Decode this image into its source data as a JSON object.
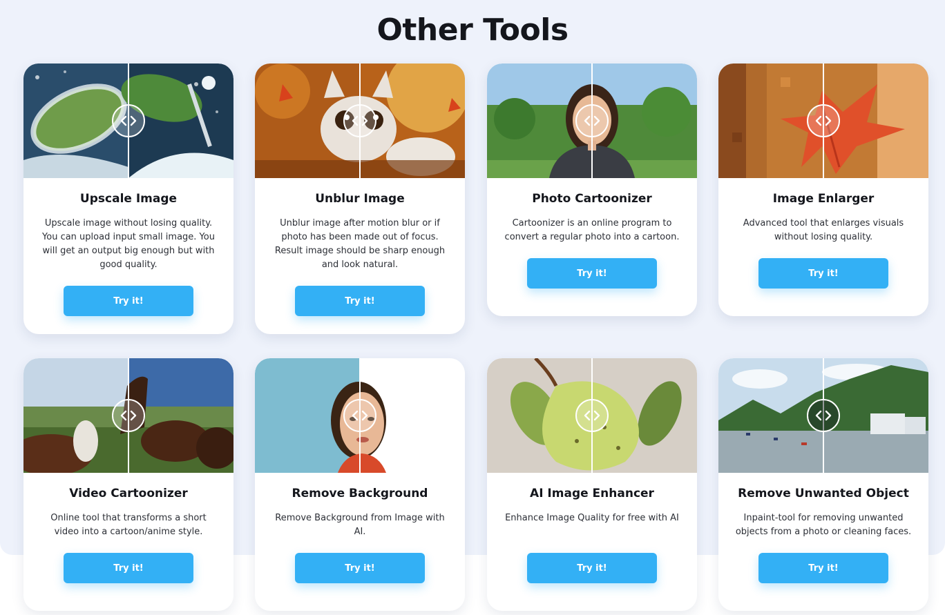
{
  "page_title": "Other Tools",
  "colors": {
    "page_background": "#eef2fb",
    "button": "#33b0f5",
    "title_text": "#14161c"
  },
  "tools": [
    {
      "title": "Upscale Image",
      "description": "Upscale image without losing quality. You can upload input small image. You will get an output big enough but with good quality.",
      "button_label": "Try it!"
    },
    {
      "title": "Unblur Image",
      "description": "Unblur image after motion blur or if photo has been made out of focus. Result image should be sharp enough and look natural.",
      "button_label": "Try it!"
    },
    {
      "title": "Photo Cartoonizer",
      "description": "Cartoonizer is an online program to convert a regular photo into a cartoon.",
      "button_label": "Try it!"
    },
    {
      "title": "Image Enlarger",
      "description": "Advanced tool that enlarges visuals without losing quality.",
      "button_label": "Try it!"
    },
    {
      "title": "Video Cartoonizer",
      "description": "Online tool that transforms a short video into a cartoon/anime style.",
      "button_label": "Try it!"
    },
    {
      "title": "Remove Background",
      "description": "Remove Background from Image with AI.",
      "button_label": "Try it!"
    },
    {
      "title": "AI Image Enhancer",
      "description": "Enhance Image Quality for free with AI",
      "button_label": "Try it!"
    },
    {
      "title": "Remove Unwanted Object",
      "description": "Inpaint-tool for removing unwanted objects from a photo or cleaning faces.",
      "button_label": "Try it!"
    }
  ]
}
